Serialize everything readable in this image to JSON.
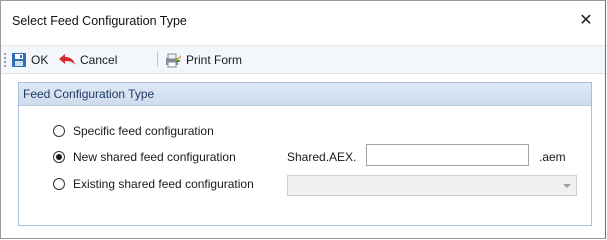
{
  "window": {
    "title": "Select Feed Configuration Type",
    "close_glyph": "✕"
  },
  "toolbar": {
    "ok_label": "OK",
    "cancel_label": "Cancel",
    "print_label": "Print Form",
    "icons": [
      "save-icon",
      "back-arrow-icon",
      "print-form-icon"
    ]
  },
  "group": {
    "title": "Feed Configuration Type",
    "options": [
      {
        "label": "Specific feed configuration",
        "checked": false
      },
      {
        "label": "New shared feed configuration",
        "checked": true
      },
      {
        "label": "Existing shared feed configuration",
        "checked": false
      }
    ],
    "shared_prefix": "Shared.AEX.",
    "shared_value": "",
    "shared_suffix": ".aem",
    "existing_value": ""
  },
  "colors": {
    "group_header": "#dfe9f6",
    "group_title_text": "#1f3a63",
    "toolbar_bg": "#f3f6fb",
    "accent_red": "#d42a2a",
    "save_blue": "#2f6db5"
  }
}
